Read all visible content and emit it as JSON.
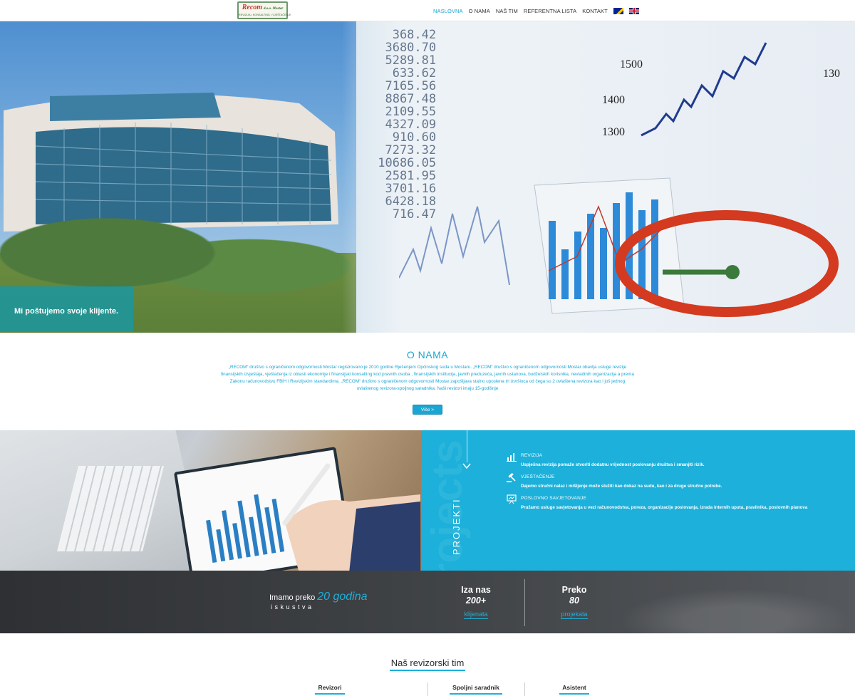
{
  "nav": {
    "logo_brand": "Recom",
    "logo_suffix": "d.o.o. Mostar",
    "logo_tagline": "REVIZIJA • KONSALTING • VJEŠTAČENJE",
    "items": [
      {
        "label": "NASLOVNA",
        "active": true
      },
      {
        "label": "O NAMA",
        "active": false
      },
      {
        "label": "NAŠ TIM",
        "active": false
      },
      {
        "label": "REFERENTNA LISTA",
        "active": false
      },
      {
        "label": "KONTAKT",
        "active": false
      }
    ],
    "languages": [
      "bosnian-flag-icon",
      "english-flag-icon"
    ]
  },
  "hero": {
    "caption": "Mi poštujemo svoje klijente."
  },
  "about": {
    "title": "O NAMA",
    "text": "„RECOM“ društvo  s ograničenom odgovornosti  Mostar registrovano je 2010 godine Rješenjem Općinskog suda u Mostaru. „RECOM“ društvo  s ograničenom odgovornosti  Mostar obavlja usluge revizije  finansijskih izvještaja, vještačenja iz oblasti ekonomije i  finansijski konsalting kod  pravnih osoba , finansijskih institucija,  javnih  preduzeća, javnih ustanova,  budžetskih korisnika, nevladinih organizacija a  prema Zakonu računovodstvu FBiH i Revizijskim standardima. „RECOM“ društvo  s ograničenom odgovornosti  Mostar zapošljava stalno uposlena tri izvršioca od čega su 2 ovlaštena revizora  kao i još jednog  ovlaštenog revizora-spoljnog saradnika. Naši  revizori imaju 15-godišnje",
    "more_button": "Više >"
  },
  "projects": {
    "label": "PROJEKTI",
    "watermark": "rojects",
    "services": [
      {
        "icon": "chart-icon",
        "title": "REVIZIJA",
        "desc": "Uspješna revizija pomaže stvoriti dodatnu vrijednost poslovanju društva i smanjiti rizik."
      },
      {
        "icon": "gavel-icon",
        "title": "VJEŠTAČENJE",
        "desc": "Dajemo stručni nalaz i mišljenje može služiti kao dokaz na sudu, kao i za druge stručne potrebe."
      },
      {
        "icon": "presentation-icon",
        "title": "POSLOVNO SAVJETOVANJE",
        "desc": "Pružamo usluge savjetovanja u vezi računovodstva, poreza, organizacije poslovanja, izrada internih uputa, pravilnika, poslovnih planova"
      }
    ]
  },
  "stats": {
    "experience_prefix": "Imamo preko",
    "experience_value": "20 godina",
    "experience_suffix": "iskustva",
    "clients": {
      "line1": "Iza nas",
      "line2": "200+",
      "label": "klijenata"
    },
    "projects": {
      "line1": "Preko",
      "line2": "80",
      "label": "projekata"
    }
  },
  "team": {
    "title": "Naš revizorski tim",
    "columns": [
      "Revizori",
      "Spoljni saradnik",
      "Asistent"
    ]
  },
  "colors": {
    "accent": "#1aa6d3",
    "projects_bg": "#1cb0da",
    "stats_bg": "#2e3033",
    "hero_caption_bg": "#1b96a0",
    "logo_red": "#c43a24"
  }
}
